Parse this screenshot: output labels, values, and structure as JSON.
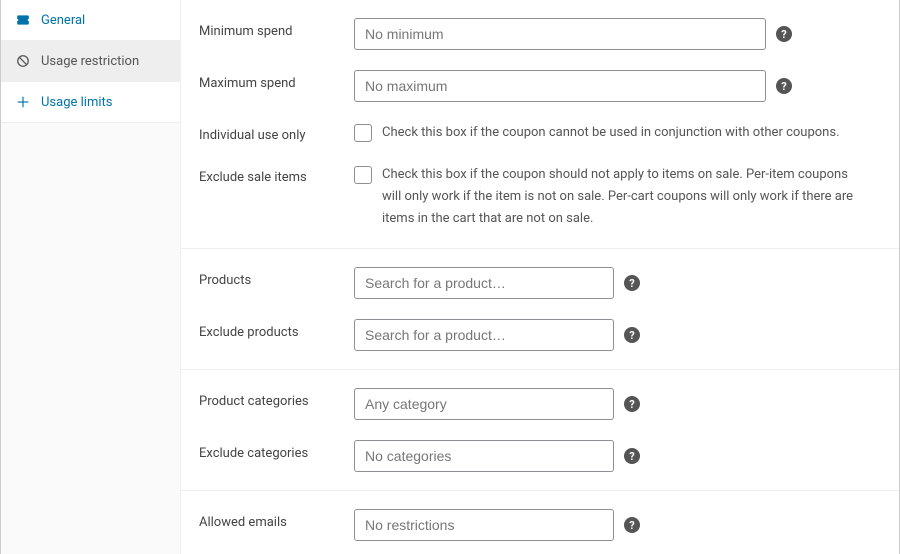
{
  "sidebar": {
    "items": [
      {
        "label": "General"
      },
      {
        "label": "Usage restriction"
      },
      {
        "label": "Usage limits"
      }
    ]
  },
  "fields": {
    "min_spend": {
      "label": "Minimum spend",
      "placeholder": "No minimum"
    },
    "max_spend": {
      "label": "Maximum spend",
      "placeholder": "No maximum"
    },
    "individual_use": {
      "label": "Individual use only",
      "desc": "Check this box if the coupon cannot be used in conjunction with other coupons."
    },
    "exclude_sale": {
      "label": "Exclude sale items",
      "desc": "Check this box if the coupon should not apply to items on sale. Per-item coupons will only work if the item is not on sale. Per-cart coupons will only work if there are items in the cart that are not on sale."
    },
    "products": {
      "label": "Products",
      "placeholder": "Search for a product…"
    },
    "exclude_products": {
      "label": "Exclude products",
      "placeholder": "Search for a product…"
    },
    "product_categories": {
      "label": "Product categories",
      "placeholder": "Any category"
    },
    "exclude_categories": {
      "label": "Exclude categories",
      "placeholder": "No categories"
    },
    "allowed_emails": {
      "label": "Allowed emails",
      "placeholder": "No restrictions"
    }
  },
  "help_glyph": "?"
}
